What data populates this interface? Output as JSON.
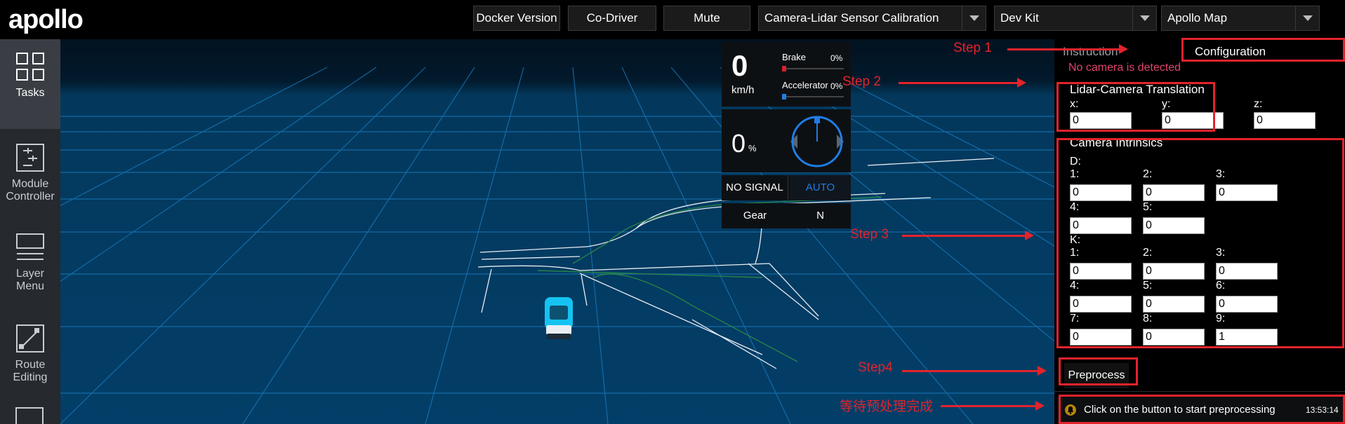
{
  "app": {
    "logo_text": "apollo"
  },
  "toolbar": {
    "docker_version": "Docker Version",
    "co_driver": "Co-Driver",
    "mute": "Mute",
    "mode_select": "Camera-Lidar Sensor Calibration",
    "vehicle_select": "Dev Kit",
    "map_select": "Apollo Map"
  },
  "sidebar": {
    "items": [
      {
        "label_line1": "Tasks",
        "label_line2": "",
        "icon": "tasks-grid-icon"
      },
      {
        "label_line1": "Module",
        "label_line2": "Controller",
        "icon": "module-controller-icon"
      },
      {
        "label_line1": "Layer",
        "label_line2": "Menu",
        "icon": "layer-menu-icon"
      },
      {
        "label_line1": "Route",
        "label_line2": "Editing",
        "icon": "route-editing-icon"
      }
    ]
  },
  "dashboard": {
    "speed_value": "0",
    "speed_unit": "km/h",
    "brake_label": "Brake",
    "brake_pct_text": "0%",
    "brake_level": 0,
    "accel_label": "Accelerator",
    "accel_pct_text": "0%",
    "accel_level": 0,
    "steer_value": "0",
    "steer_unit": "%",
    "signal_text": "NO SIGNAL",
    "drive_mode": "AUTO",
    "gear_label": "Gear",
    "gear_value": "N"
  },
  "config": {
    "tab_instruction": "Instruction",
    "tab_configuration": "Configuration",
    "warning": "No camera is detected",
    "translation": {
      "title": "Lidar-Camera Translation",
      "x_label": "x:",
      "x": "0",
      "y_label": "y:",
      "y": "0",
      "z_label": "z:",
      "z": "0"
    },
    "intrinsics": {
      "title": "Camera Intrinsics",
      "d_label": "D:",
      "d": [
        {
          "label": "1:",
          "value": "0"
        },
        {
          "label": "2:",
          "value": "0"
        },
        {
          "label": "3:",
          "value": "0"
        },
        {
          "label": "4:",
          "value": "0"
        },
        {
          "label": "5:",
          "value": "0"
        }
      ],
      "k_label": "K:",
      "k": [
        {
          "label": "1:",
          "value": "0"
        },
        {
          "label": "2:",
          "value": "0"
        },
        {
          "label": "3:",
          "value": "0"
        },
        {
          "label": "4:",
          "value": "0"
        },
        {
          "label": "5:",
          "value": "0"
        },
        {
          "label": "6:",
          "value": "0"
        },
        {
          "label": "7:",
          "value": "0"
        },
        {
          "label": "8:",
          "value": "0"
        },
        {
          "label": "9:",
          "value": "1"
        }
      ]
    },
    "preprocess_button": "Preprocess",
    "status_message": "Click on the button to start preprocessing",
    "status_time": "13:53:14"
  },
  "annotations": {
    "step1": "Step 1",
    "step2": "Step 2",
    "step3": "Step 3",
    "step4": "Step4",
    "waiting": "等待预处理完成"
  },
  "colors": {
    "annotation_red": "#e3232c",
    "warning_pink": "#e0456b",
    "accent_blue": "#1f7de6",
    "sidebar_bg": "#26292d"
  }
}
